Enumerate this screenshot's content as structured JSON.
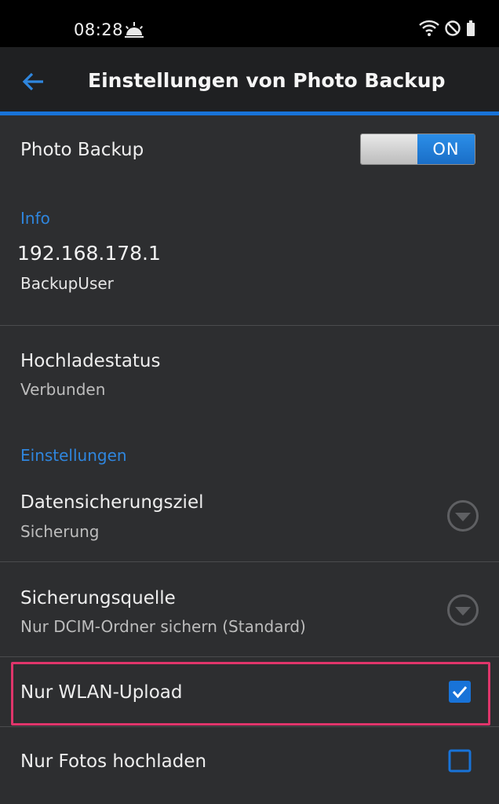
{
  "status_bar": {
    "time": "08:28",
    "icons": [
      "weather-sunrise-icon",
      "wifi-icon",
      "do-not-disturb-icon",
      "battery-icon"
    ]
  },
  "app_bar": {
    "title": "Einstellungen von Photo Backup",
    "back_icon": "arrow-left-icon"
  },
  "photo_backup": {
    "label": "Photo Backup",
    "toggle_state": "ON"
  },
  "info_section": {
    "label": "Info",
    "ip_address": "192.168.178.1",
    "user": "BackupUser"
  },
  "upload_status": {
    "title": "Hochladestatus",
    "value": "Verbunden"
  },
  "settings_section": {
    "label": "Einstellungen"
  },
  "backup_target": {
    "title": "Datensicherungsziel",
    "value": "Sicherung"
  },
  "backup_source": {
    "title": "Sicherungsquelle",
    "value": "Nur DCIM-Ordner sichern (Standard)"
  },
  "wifi_only": {
    "title": "Nur WLAN-Upload",
    "checked": true
  },
  "photos_only": {
    "title": "Nur Fotos hochladen",
    "checked": false
  },
  "colors": {
    "accent": "#1873d8",
    "section_label": "#2f86de",
    "highlight": "#e0356b",
    "background": "#2d2e30"
  }
}
